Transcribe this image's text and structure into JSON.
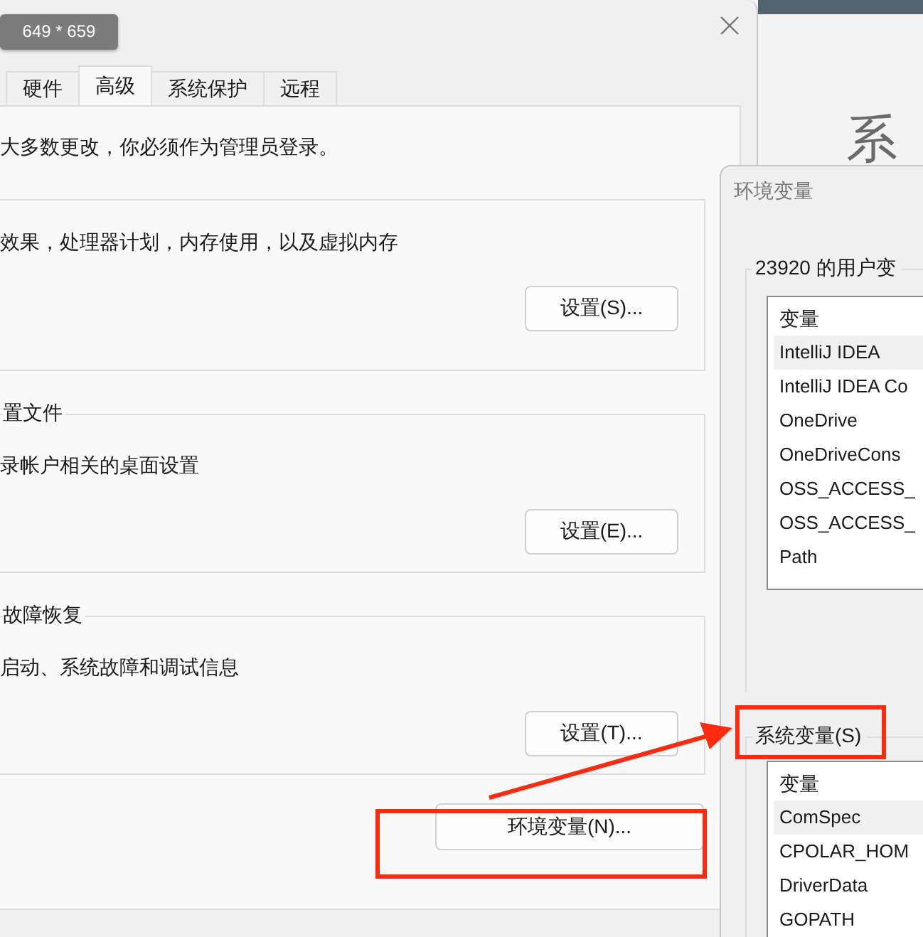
{
  "size_badge": "649 * 659",
  "system_properties": {
    "tabs": [
      {
        "label": "硬件",
        "selected": false
      },
      {
        "label": "高级",
        "selected": true
      },
      {
        "label": "系统保护",
        "selected": false
      },
      {
        "label": "远程",
        "selected": false
      }
    ],
    "admin_note": "大多数更改，你必须作为管理员登录。",
    "groups": [
      {
        "description": "效果，处理器计划，内存使用，以及虚拟内存",
        "button": "设置(S)..."
      },
      {
        "label": "置文件",
        "description": "录帐户相关的桌面设置",
        "button": "设置(E)..."
      },
      {
        "label": "故障恢复",
        "description": "启动、系统故障和调试信息",
        "button": "设置(T)..."
      }
    ],
    "env_button": "环境变量(N)..."
  },
  "background_window": {
    "heading": "系"
  },
  "environment_dialog": {
    "title": "环境变量",
    "user_variables": {
      "label": "23920 的用户变",
      "header": "变量",
      "rows": [
        {
          "name": "IntelliJ IDEA",
          "selected": true
        },
        {
          "name": "IntelliJ IDEA Co",
          "selected": false
        },
        {
          "name": "OneDrive",
          "selected": false
        },
        {
          "name": "OneDriveCons",
          "selected": false
        },
        {
          "name": "OSS_ACCESS_",
          "selected": false
        },
        {
          "name": "OSS_ACCESS_",
          "selected": false
        },
        {
          "name": "Path",
          "selected": false
        }
      ]
    },
    "system_variables": {
      "label": "系统变量(S)",
      "header": "变量",
      "rows": [
        {
          "name": "ComSpec",
          "selected": true
        },
        {
          "name": "CPOLAR_HOM",
          "selected": false
        },
        {
          "name": "DriverData",
          "selected": false
        },
        {
          "name": "GOPATH",
          "selected": false
        }
      ]
    }
  }
}
